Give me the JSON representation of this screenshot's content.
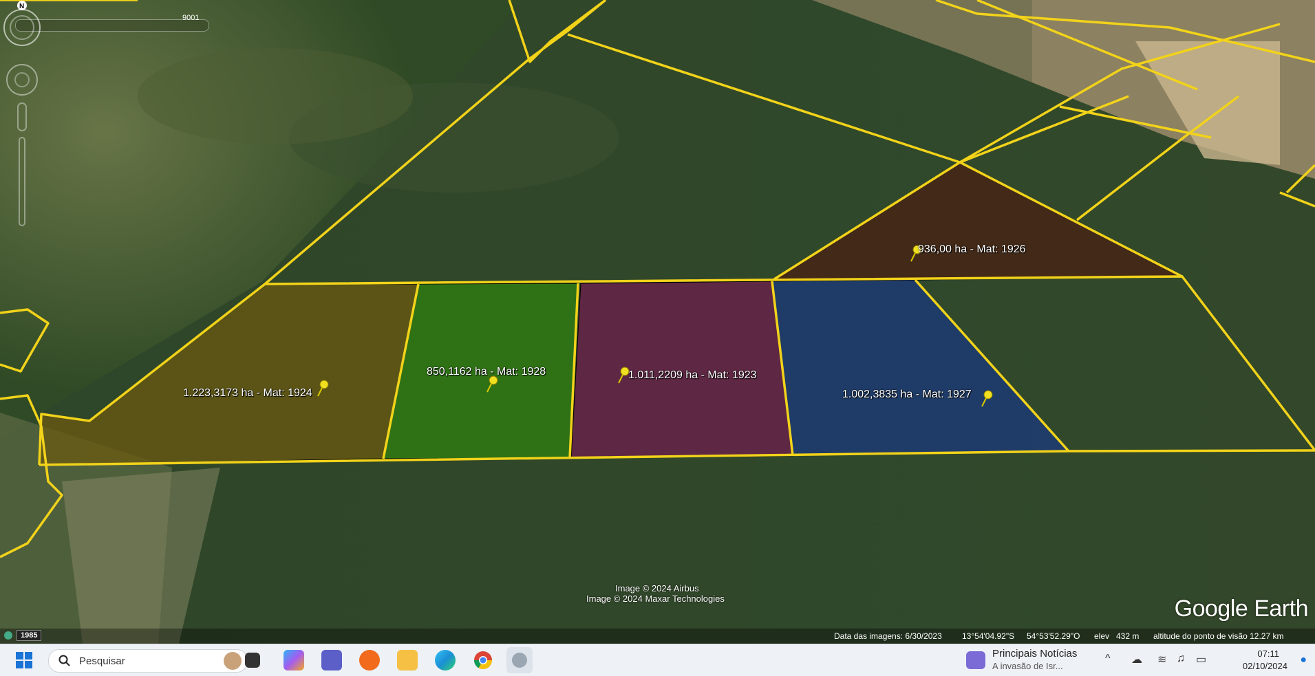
{
  "map": {
    "slider_value": "9001",
    "parcels": [
      {
        "label": "1.223,3173 ha - Mat: 1924",
        "color": "#6b5a10"
      },
      {
        "label": "850,1162 ha - Mat: 1928",
        "color": "#2f7d12"
      },
      {
        "label": "1.011,2209 ha - Mat: 1923",
        "color": "#6a1f4a"
      },
      {
        "label": "1.002,3835 ha - Mat: 1927",
        "color": "#1c3a78"
      },
      {
        "label": "936,00 ha - Mat: 1926",
        "color": "#4a1f12"
      }
    ],
    "boundary_color": "#f2d31a",
    "credits": [
      "Image © 2024 Airbus",
      "Image © 2024 Maxar Technologies"
    ],
    "logo": "Google Earth",
    "history_badge": "1985",
    "compass": "N"
  },
  "status": {
    "imagery_date": "Data das imagens: 6/30/2023",
    "lat": "13°54'04.92\"S",
    "lon": "54°53'52.29\"O",
    "elev_label": "elev",
    "elev": "432 m",
    "eye_alt": "altitude do ponto de visão  12.27 km"
  },
  "taskbar": {
    "search_placeholder": "Pesquisar",
    "apps": [
      "windows-start-icon",
      "task-view-icon",
      "copilot-icon",
      "teams-icon",
      "app-orange-icon",
      "file-explorer-icon",
      "edge-icon",
      "chrome-icon",
      "google-earth-pro-icon"
    ],
    "news_title": "Principais Notícias",
    "news_sub": "A invasão de Isr...",
    "time": "07:11",
    "date": "02/10/2024"
  }
}
